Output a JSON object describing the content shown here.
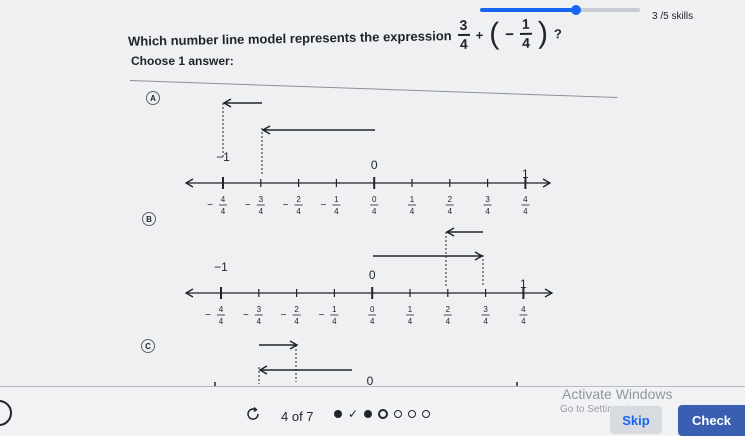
{
  "header": {
    "skills_progress": "3 /5 skills",
    "progress_fraction": 0.6
  },
  "question": {
    "prefix": "Which number line model represents the expression",
    "frac1_num": "3",
    "frac1_den": "4",
    "plus": "+",
    "open_paren": "(",
    "neg": "−",
    "frac2_num": "1",
    "frac2_den": "4",
    "close_paren": ")",
    "qmark": "?"
  },
  "prompt": "Choose 1 answer:",
  "choices": [
    {
      "letter": "A",
      "labels": {
        "minus_one": "−1",
        "zero": "0",
        "one": "1"
      },
      "tick_numerators": [
        "−4",
        "−3",
        "−2",
        "−1",
        "0",
        "1",
        "2",
        "3",
        "4"
      ],
      "tick_denominator": "4",
      "neg_signs": [
        "−",
        "−",
        "−",
        "−",
        "",
        "",
        "",
        "",
        ""
      ]
    },
    {
      "letter": "B",
      "labels": {
        "minus_one": "−1",
        "zero": "0",
        "one": "1"
      },
      "tick_numerators": [
        "−4",
        "−3",
        "−2",
        "−1",
        "0",
        "1",
        "2",
        "3",
        "4"
      ],
      "tick_denominator": "4",
      "neg_signs": [
        "−",
        "−",
        "−",
        "−",
        "",
        "",
        "",
        "",
        ""
      ]
    },
    {
      "letter": "C",
      "labels": {
        "zero": "0"
      }
    }
  ],
  "footer": {
    "counter": "4 of 7",
    "skip_label": "Skip",
    "check_label": "Check"
  },
  "watermark": {
    "title": "Activate Windows",
    "subtitle": "Go to Settings to ac"
  }
}
